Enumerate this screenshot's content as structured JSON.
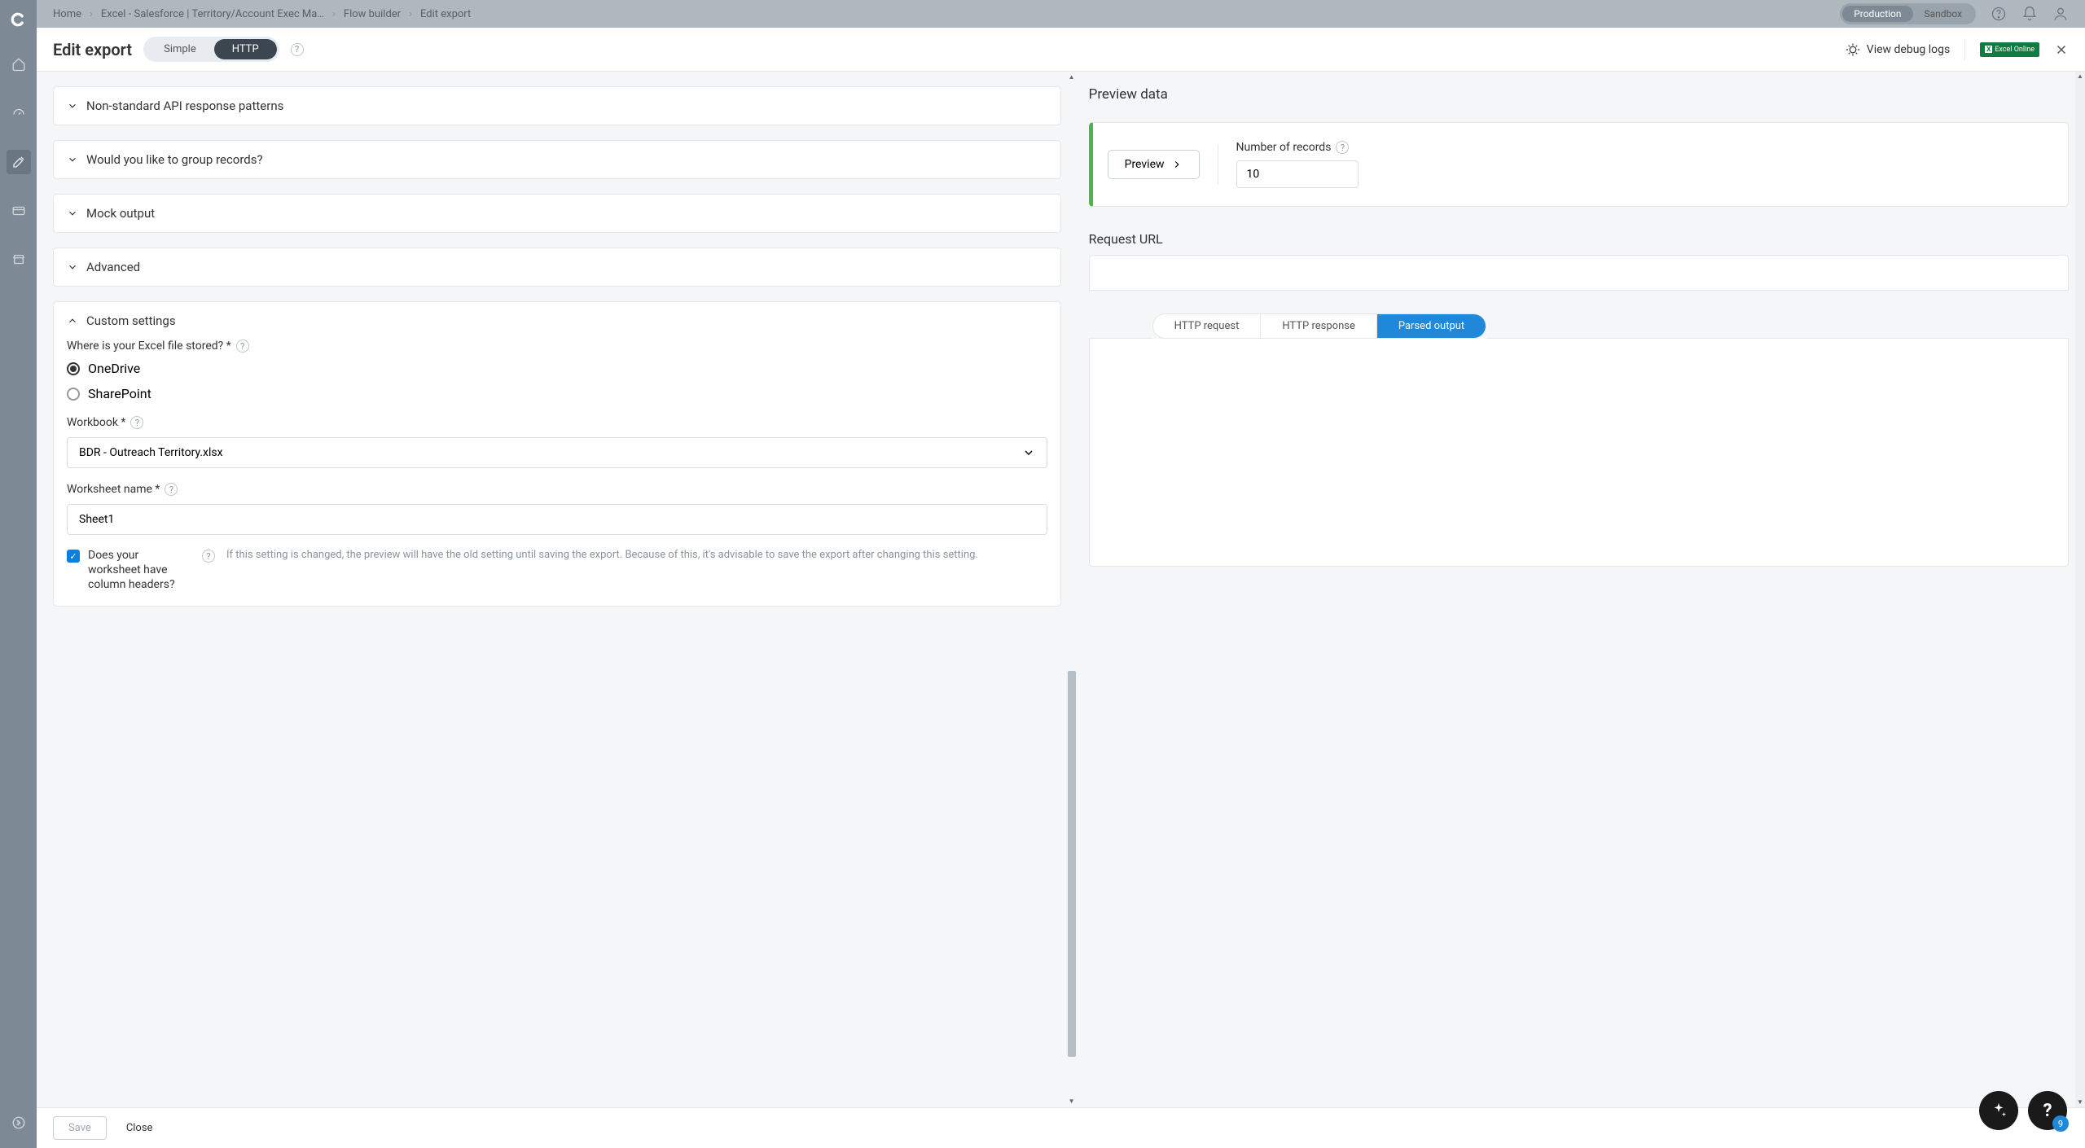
{
  "sidebar": {
    "logo": "C"
  },
  "topbar": {
    "breadcrumbs": [
      "Home",
      "Excel - Salesforce | Territory/Account Exec Ma…",
      "Flow builder",
      "Edit export"
    ],
    "env": {
      "production": "Production",
      "sandbox": "Sandbox"
    }
  },
  "header": {
    "title": "Edit export",
    "modes": {
      "simple": "Simple",
      "http": "HTTP"
    },
    "debug": "View debug logs",
    "excel_badge": "Excel Online"
  },
  "panels": {
    "nonstandard": "Non-standard API response patterns",
    "group": "Would you like to group records?",
    "mock": "Mock output",
    "advanced": "Advanced",
    "custom": "Custom settings"
  },
  "custom": {
    "storage_label": "Where is your Excel file stored? *",
    "onedrive": "OneDrive",
    "sharepoint": "SharePoint",
    "workbook_label": "Workbook *",
    "workbook_value": "BDR - Outreach Territory.xlsx",
    "worksheet_label": "Worksheet name *",
    "worksheet_value": "Sheet1",
    "headers_label": "Does your worksheet have column headers?",
    "headers_help": "If this setting is changed, the preview will have the old setting until saving the export. Because of this, it's advisable to save the export after changing this setting."
  },
  "preview": {
    "title": "Preview data",
    "button": "Preview",
    "records_label": "Number of records",
    "records_value": "10",
    "url_label": "Request URL",
    "tabs": {
      "request": "HTTP request",
      "response": "HTTP response",
      "parsed": "Parsed output"
    }
  },
  "footer": {
    "save": "Save",
    "close": "Close"
  },
  "float": {
    "badge": "9"
  }
}
